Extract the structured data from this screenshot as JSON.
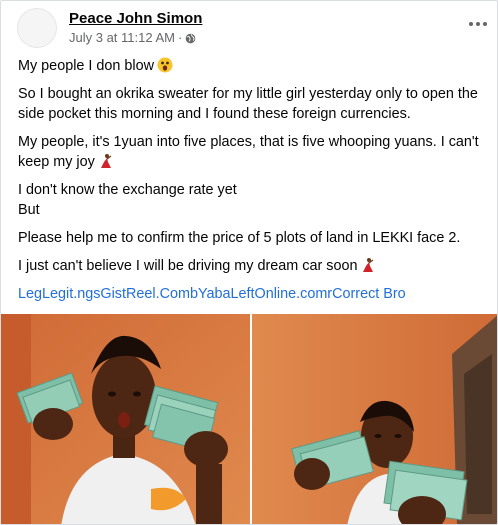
{
  "post": {
    "author": "Peace John Simon",
    "timestamp": "July 3 at 11:12 AM",
    "separator": "·",
    "privacy_icon": "globe-icon",
    "menu_icon": "more-options-icon",
    "paragraphs": {
      "p1": "My people I don blow",
      "p2": "So I bought an okrika sweater for my little girl yesterday only to open the side pocket this morning and I found these foreign currencies.",
      "p3": "My people, it's 1yuan into five places, that is five whooping yuans. I can't keep my joy",
      "p4": "I don't know the exchange rate yet",
      "p5": "But",
      "p6": "Please help me to confirm the price of 5 plots of land in LEKKI face 2.",
      "p7": "I just can't believe I will be driving my dream car soon",
      "p8": "LegLegit.ngsGistReel.CombYabaLeftOnline.comrCorrect Bro"
    },
    "emojis": {
      "p1": "astonished-face-emoji",
      "p3": "woman-dancing-emoji",
      "p7": "woman-dancing-emoji"
    }
  },
  "colors": {
    "link": "#216fdb",
    "meta": "#65676b",
    "wall": "#d9743a",
    "shirt": "#f3f3f3",
    "notes": "#7ebfa8"
  },
  "photos": [
    "photo-girl-holding-notes-left",
    "photo-girl-holding-notes-right"
  ]
}
